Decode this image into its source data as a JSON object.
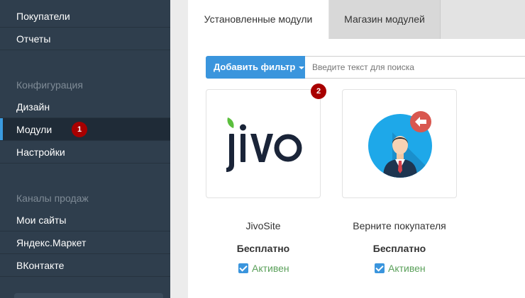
{
  "sidebar": {
    "items_top": [
      {
        "label": "Покупатели"
      },
      {
        "label": "Отчеты"
      }
    ],
    "section_config": "Конфигурация",
    "items_config": [
      {
        "label": "Дизайн"
      },
      {
        "label": "Модули",
        "active": true
      },
      {
        "label": "Настройки"
      }
    ],
    "section_channels": "Каналы продаж",
    "items_channels": [
      {
        "label": "Мои сайты"
      },
      {
        "label": "Яндекс.Маркет"
      },
      {
        "label": "ВКонтакте"
      }
    ],
    "badge_modules": "1"
  },
  "main": {
    "tabs": [
      {
        "label": "Установленные модули",
        "active": true
      },
      {
        "label": "Магазин модулей",
        "active": false
      }
    ],
    "filter_button": "Добавить фильтр",
    "search_placeholder": "Введите текст для поиска",
    "badge_card": "2",
    "modules": [
      {
        "logo_text": "jivo",
        "name": "JivoSite",
        "price": "Бесплатно",
        "status": "Активен",
        "enabled": true
      },
      {
        "logo_icon": "customer-return-icon",
        "name": "Верните покупателя",
        "price": "Бесплатно",
        "status": "Активен",
        "enabled": true
      }
    ]
  },
  "colors": {
    "sidebar_bg": "#2f3e4d",
    "accent": "#3a95dd",
    "badge": "#a80000",
    "active_status": "#5aa05a"
  }
}
